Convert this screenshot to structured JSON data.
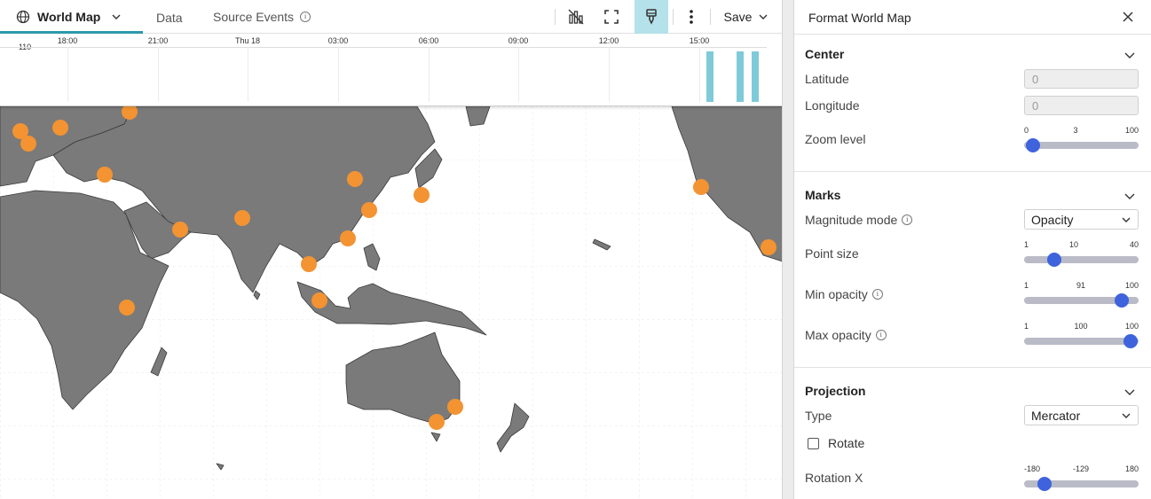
{
  "tabs": [
    {
      "label": "World Map",
      "active": true
    },
    {
      "label": "Data",
      "active": false
    },
    {
      "label": "Source Events",
      "active": false
    }
  ],
  "toolbar": {
    "save_label": "Save",
    "icons": [
      "chart-toggle-icon",
      "fullscreen-icon",
      "format-brush-icon",
      "more-vertical-icon"
    ]
  },
  "timeline": {
    "y_max_label": "110",
    "x_labels": [
      "18:00",
      "21:00",
      "Thu 18",
      "03:00",
      "06:00",
      "09:00",
      "12:00",
      "15:00"
    ],
    "bars": [
      {
        "position": "15:45",
        "value": 110
      },
      {
        "position": "16:30",
        "value": 110
      },
      {
        "position": "17:00",
        "value": 110
      }
    ],
    "bar_color": "#7fcad9"
  },
  "map": {
    "land_color": "#7a7a7a",
    "marker_color": "#f39332",
    "marker_count": 19
  },
  "panel": {
    "title": "Format World Map",
    "center": {
      "title": "Center",
      "latitude_label": "Latitude",
      "latitude_value": "0",
      "longitude_label": "Longitude",
      "longitude_value": "0",
      "zoom_label": "Zoom level",
      "zoom": {
        "min": "0",
        "value": "3",
        "max": "100"
      }
    },
    "marks": {
      "title": "Marks",
      "magnitude_label": "Magnitude mode",
      "magnitude_value": "Opacity",
      "point_size_label": "Point size",
      "point_size": {
        "min": "1",
        "value": "10",
        "max": "40"
      },
      "min_opacity_label": "Min opacity",
      "min_opacity": {
        "min": "1",
        "value": "91",
        "max": "100"
      },
      "max_opacity_label": "Max opacity",
      "max_opacity": {
        "min": "1",
        "value": "100",
        "max": "100"
      }
    },
    "projection": {
      "title": "Projection",
      "type_label": "Type",
      "type_value": "Mercator",
      "rotate_label": "Rotate",
      "rotate_checked": false,
      "rotation_x_label": "Rotation X",
      "rotation_x": {
        "min": "-180",
        "value": "-129",
        "max": "180"
      }
    }
  }
}
